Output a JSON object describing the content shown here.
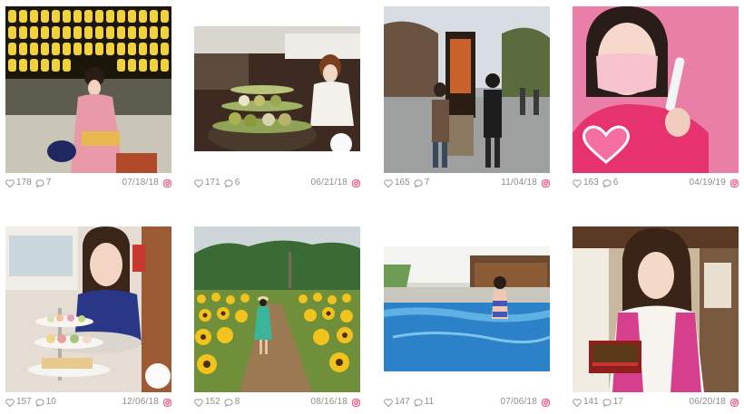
{
  "posts": [
    {
      "likes": "178",
      "comments": "7",
      "date": "07/18/18",
      "image": "woman in pink kimono with lanterns"
    },
    {
      "likes": "171",
      "comments": "6",
      "date": "06/21/18",
      "image": "matcha afternoon tea set"
    },
    {
      "likes": "165",
      "comments": "7",
      "date": "11/04/18",
      "image": "two women by temple signpost"
    },
    {
      "likes": "163",
      "comments": "6",
      "date": "04/19/19",
      "image": "woman in mask holding pen"
    },
    {
      "likes": "157",
      "comments": "10",
      "date": "12/06/18",
      "image": "woman with afternoon tea stand"
    },
    {
      "likes": "152",
      "comments": "8",
      "date": "08/16/18",
      "image": "woman in sunflower field"
    },
    {
      "likes": "147",
      "comments": "11",
      "date": "07/06/18",
      "image": "woman in outdoor pool"
    },
    {
      "likes": "141",
      "comments": "17",
      "date": "06/20/18",
      "image": "woman holding eel box"
    }
  ],
  "icons": {
    "like": "heart-icon",
    "comment": "comment-icon",
    "source": "instagram-icon"
  },
  "colors": {
    "text": "#8c8c8c",
    "instagram": "#e1306c"
  }
}
